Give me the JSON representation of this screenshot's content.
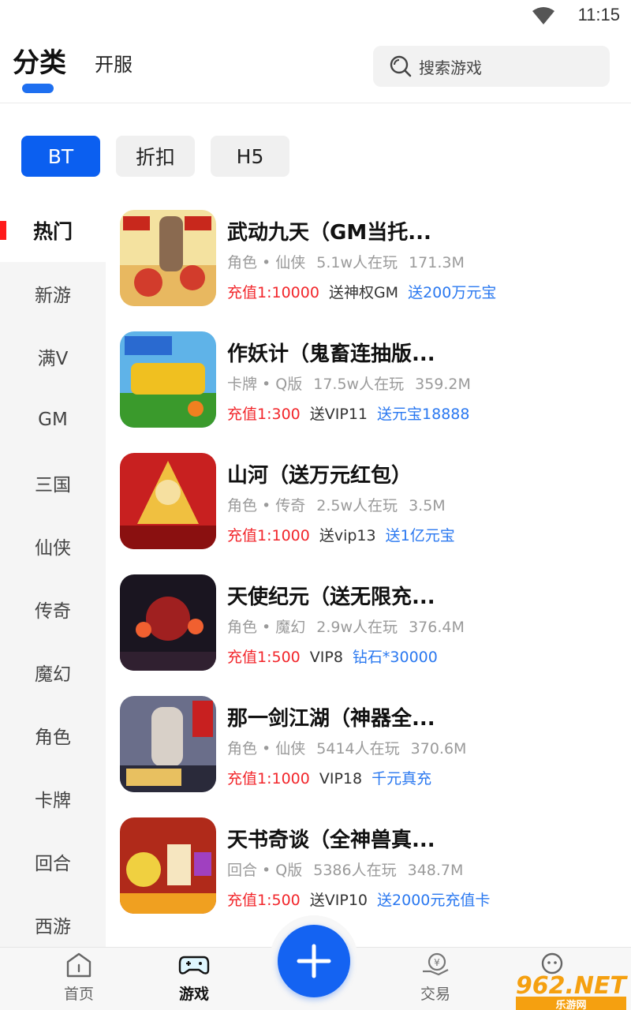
{
  "status_bar": {
    "time": "11:15"
  },
  "header": {
    "tabs": [
      {
        "label": "分类",
        "active": true
      },
      {
        "label": "开服",
        "active": false
      }
    ],
    "search": {
      "placeholder": "搜索游戏"
    }
  },
  "chips": [
    {
      "label": "BT",
      "active": true
    },
    {
      "label": "折扣",
      "active": false
    },
    {
      "label": "H5",
      "active": false
    }
  ],
  "categories": [
    "热门",
    "新游",
    "满V",
    "GM",
    "三国",
    "仙侠",
    "传奇",
    "魔幻",
    "角色",
    "卡牌",
    "回合",
    "西游"
  ],
  "games": [
    {
      "title": "武动九天（GM当托...",
      "genre": "角色 • 仙侠",
      "players": "5.1w人在玩",
      "size": "171.3M",
      "rate": "充值1:10000",
      "perk": "送神权GM",
      "bonus": "送200万元宝",
      "icon_colors": [
        "#f4e2a0",
        "#d23c2c"
      ]
    },
    {
      "title": "作妖计（鬼畜连抽版...",
      "genre": "卡牌 • Q版",
      "players": "17.5w人在玩",
      "size": "359.2M",
      "rate": "充值1:300",
      "perk": "送VIP11",
      "bonus": "送元宝18888",
      "icon_colors": [
        "#5fb3e8",
        "#3a9a2c"
      ]
    },
    {
      "title": "山河（送万元红包）",
      "genre": "角色 • 传奇",
      "players": "2.5w人在玩",
      "size": "3.5M",
      "rate": "充值1:1000",
      "perk": "送vip13",
      "bonus": "送1亿元宝",
      "icon_colors": [
        "#c82020",
        "#f0c040"
      ]
    },
    {
      "title": "天使纪元（送无限充...",
      "genre": "角色 • 魔幻",
      "players": "2.9w人在玩",
      "size": "376.4M",
      "rate": "充值1:500",
      "perk": "VIP8",
      "bonus": "钻石*30000",
      "icon_colors": [
        "#1a1520",
        "#a02020"
      ]
    },
    {
      "title": "那一剑江湖（神器全...",
      "genre": "角色 • 仙侠",
      "players": "5414人在玩",
      "size": "370.6M",
      "rate": "充值1:1000",
      "perk": "VIP18",
      "bonus": "千元真充",
      "icon_colors": [
        "#6a6e8a",
        "#e8c060"
      ]
    },
    {
      "title": "天书奇谈（全神兽真...",
      "genre": "回合 • Q版",
      "players": "5386人在玩",
      "size": "348.7M",
      "rate": "充值1:500",
      "perk": "送VIP10",
      "bonus": "送2000元充值卡",
      "icon_colors": [
        "#b02a1a",
        "#f0d040"
      ]
    }
  ],
  "bottom_nav": [
    {
      "label": "首页",
      "icon": "home-icon",
      "active": false
    },
    {
      "label": "游戏",
      "icon": "gamepad-icon",
      "active": true
    },
    {
      "label": "交易",
      "icon": "trade-icon",
      "active": false
    },
    {
      "label": "",
      "icon": "profile-icon",
      "active": false
    }
  ],
  "watermark": {
    "brand": "962.NET",
    "sub": "乐游网"
  }
}
